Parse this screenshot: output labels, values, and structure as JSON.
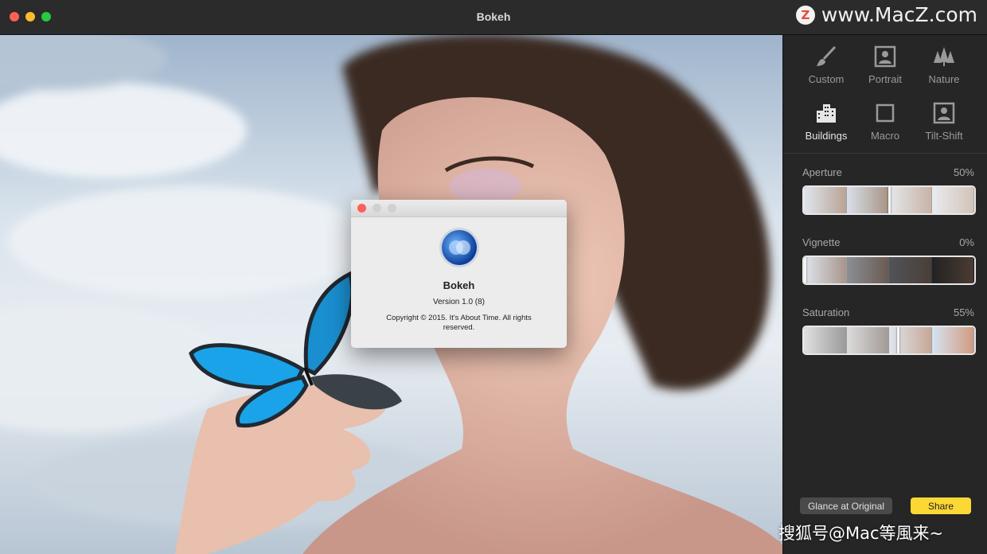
{
  "window": {
    "title": "Bokeh"
  },
  "watermark_top": "www.MacZ.com",
  "watermark_logo": "Z",
  "about_dialog": {
    "app_name": "Bokeh",
    "version": "Version 1.0 (8)",
    "copyright": "Copyright © 2015. It's About Time. All rights reserved."
  },
  "presets": [
    {
      "label": "Custom",
      "icon": "brush-icon",
      "active": false
    },
    {
      "label": "Portrait",
      "icon": "portrait-icon",
      "active": false
    },
    {
      "label": "Nature",
      "icon": "trees-icon",
      "active": false
    },
    {
      "label": "Buildings",
      "icon": "buildings-icon",
      "active": true
    },
    {
      "label": "Macro",
      "icon": "square-icon",
      "active": false
    },
    {
      "label": "Tilt-Shift",
      "icon": "portrait-icon",
      "active": false
    }
  ],
  "sliders": [
    {
      "label": "Aperture",
      "value_text": "50%",
      "value": 0.5
    },
    {
      "label": "Vignette",
      "value_text": "0%",
      "value": 0.0
    },
    {
      "label": "Saturation",
      "value_text": "55%",
      "value": 0.55
    }
  ],
  "buttons": {
    "glance": "Glance at Original",
    "share": "Share"
  },
  "watermark_bottom": "搜狐号@Mac等風来~",
  "colors": {
    "accent": "#fdd835",
    "panel": "#262626",
    "butterfly": "#1aa3e8"
  }
}
